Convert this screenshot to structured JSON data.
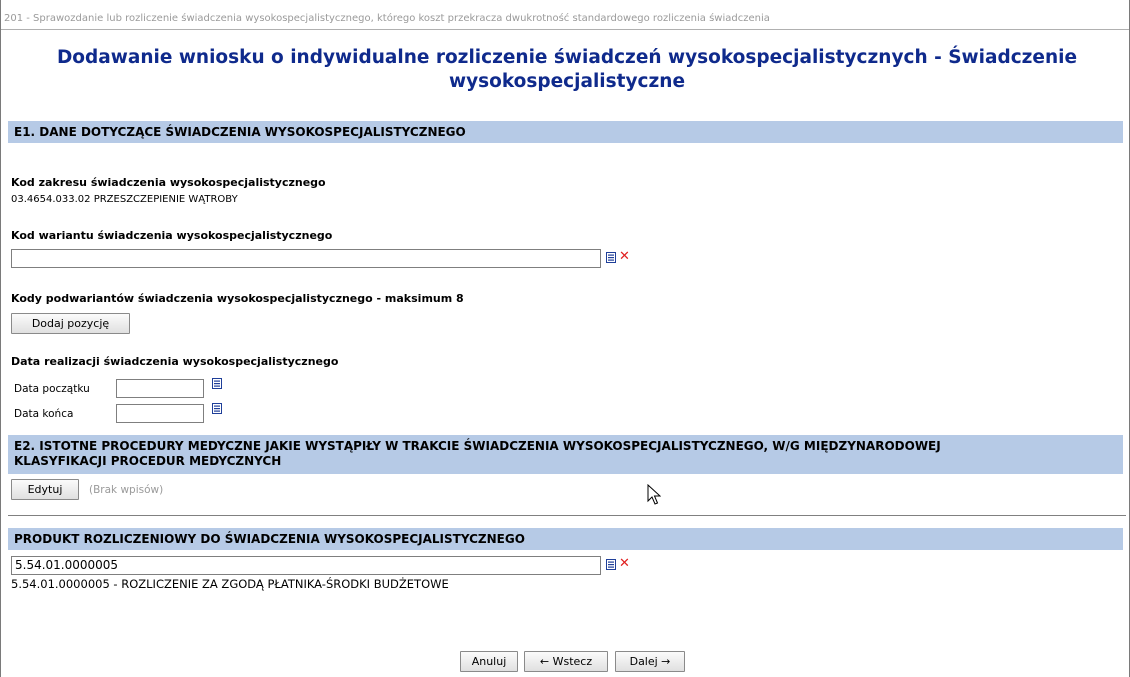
{
  "breadcrumb": "201 - Sprawozdanie lub rozliczenie świadczenia wysokospecjalistycznego, którego koszt przekracza dwukrotność standardowego rozliczenia świadczenia",
  "title_line1": "Dodawanie wniosku o indywidualne rozliczenie świadczeń wysokospecjalistycznych - Świadczenie",
  "title_line2": "wysokospecjalistyczne",
  "e1": {
    "header": "E1. DANE DOTYCZĄCE ŚWIADCZENIA WYSOKOSPECJALISTYCZNEGO",
    "scope_label": "Kod zakresu świadczenia wysokospecjalistycznego",
    "scope_value": "03.4654.033.02 PRZESZCZEPIENIE WĄTROBY",
    "variant_label": "Kod wariantu świadczenia wysokospecjalistycznego",
    "variant_value": "",
    "subvariants_label": "Kody podwariantów świadczenia wysokospecjalistycznego - maksimum 8",
    "add_button": "Dodaj pozycję",
    "date_label": "Data realizacji świadczenia wysokospecjalistycznego",
    "date_start_label": "Data początku",
    "date_start_value": "",
    "date_end_label": "Data końca",
    "date_end_value": ""
  },
  "e2": {
    "header_line1": "E2. ISTOTNE PROCEDURY MEDYCZNE JAKIE WYSTĄPIŁY W TRAKCIE ŚWIADCZENIA WYSOKOSPECJALISTYCZNEGO, W/G MIĘDZYNARODOWEJ",
    "header_line2": "KLASYFIKACJI PROCEDUR MEDYCZNYCH",
    "edit_button": "Edytuj",
    "empty_text": "(Brak wpisów)"
  },
  "product": {
    "header": "PRODUKT ROZLICZENIOWY DO ŚWIADCZENIA WYSOKOSPECJALISTYCZNEGO",
    "input_value": "5.54.01.0000005",
    "description": "5.54.01.0000005 - ROZLICZENIE ZA ZGODĄ PŁATNIKA-ŚRODKI BUDŻETOWE"
  },
  "footer": {
    "cancel": "Anuluj",
    "back": "← Wstecz",
    "next": "Dalej →"
  },
  "icons": {
    "list": "list-picker-icon",
    "clear": "clear-x-icon"
  },
  "colors": {
    "title": "#0f2a8c",
    "section_bg": "#b6cae6",
    "clear_icon": "#e02020"
  }
}
